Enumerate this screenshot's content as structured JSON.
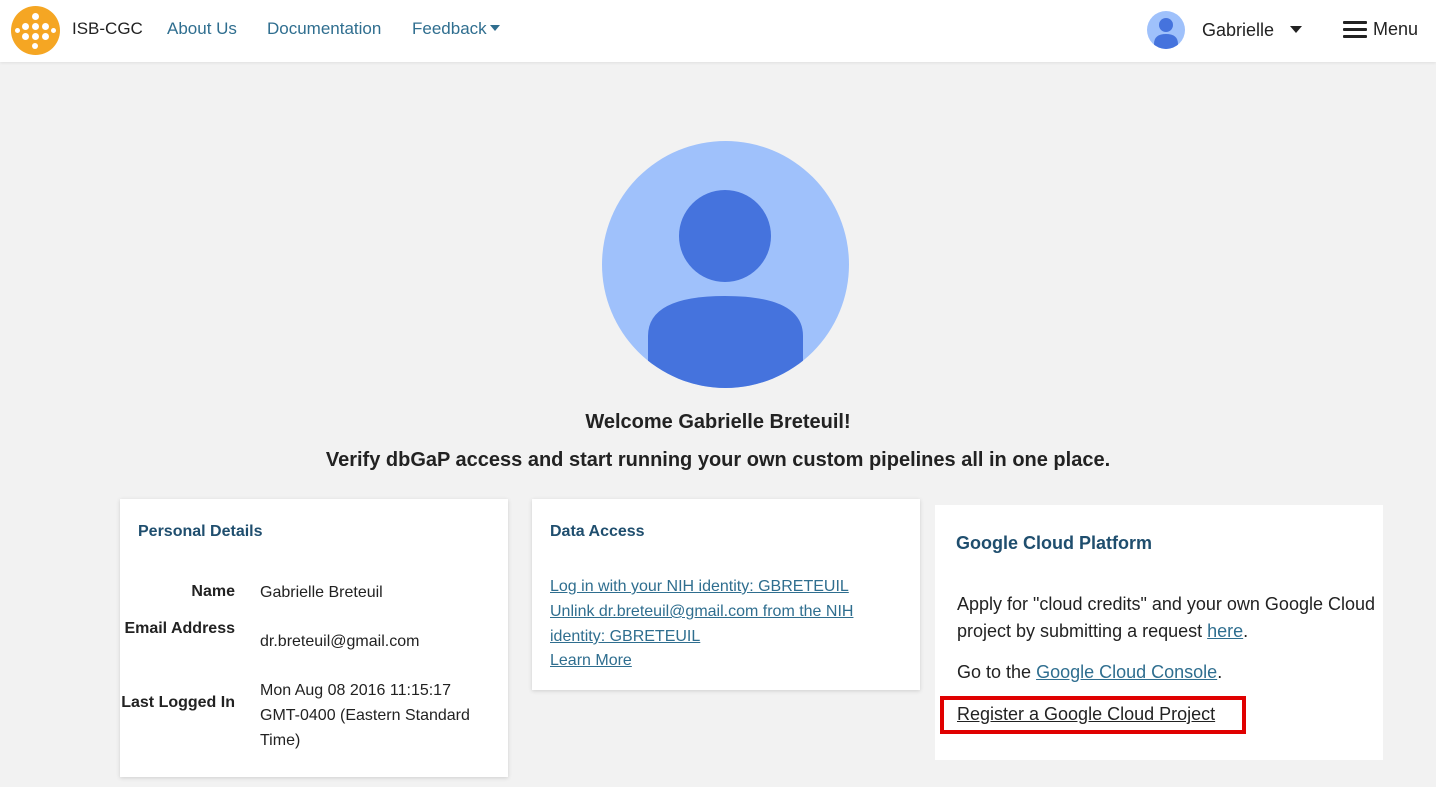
{
  "navbar": {
    "brand": "ISB-CGC",
    "links": [
      {
        "label": "About Us"
      },
      {
        "label": "Documentation"
      },
      {
        "label": "Feedback"
      }
    ],
    "user_name": "Gabrielle",
    "menu_label": "Menu"
  },
  "hero": {
    "welcome": "Welcome Gabrielle Breteuil!",
    "subtitle": "Verify dbGaP access and start running your own custom pipelines all in one place."
  },
  "personal_details": {
    "title": "Personal Details",
    "rows": [
      {
        "label": "Name",
        "value": "Gabrielle Breteuil"
      },
      {
        "label": "Email Address",
        "value": "dr.breteuil@gmail.com"
      },
      {
        "label": "Last Logged In",
        "value": "Mon Aug 08 2016 11:15:17 GMT-0400 (Eastern Standard Time)"
      }
    ]
  },
  "data_access": {
    "title": "Data Access",
    "links": [
      "Log in with your NIH identity: GBRETEUIL",
      "Unlink dr.breteuil@gmail.com from the NIH identity: GBRETEUIL",
      "Learn More"
    ]
  },
  "gcp": {
    "title": "Google Cloud Platform",
    "apply_text_before": "Apply for \"cloud credits\" and your own Google Cloud project by submitting a request ",
    "apply_link": "here",
    "apply_text_after": ".",
    "console_text_before": "Go to the ",
    "console_link": "Google Cloud Console",
    "console_text_after": ".",
    "register_link": "Register a Google Cloud Project"
  },
  "colors": {
    "brand_orange": "#f5a623",
    "link": "#2f6e8f",
    "avatar_light": "#9fc1fb",
    "avatar_dark": "#4573dd",
    "highlight": "#e00000"
  }
}
